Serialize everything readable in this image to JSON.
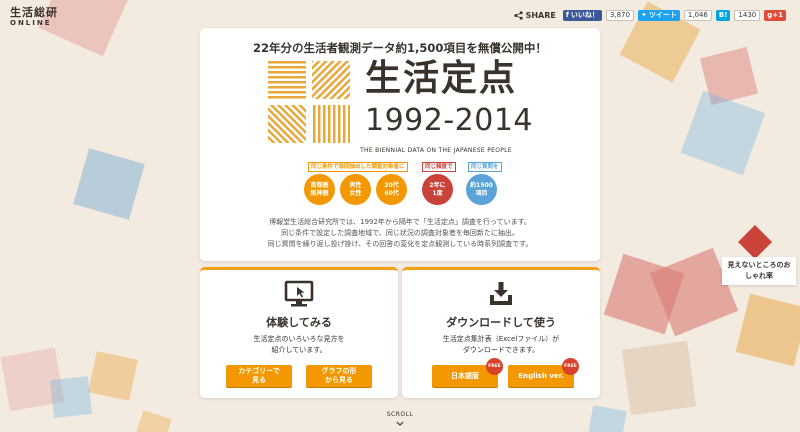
{
  "logo": {
    "top": "生活総研",
    "bottom": "ONLINE"
  },
  "share": {
    "label": "SHARE",
    "facebook": {
      "label": "いいね！",
      "count": "3,870",
      "color": "#3b5998"
    },
    "twitter": {
      "label": "ツイート",
      "count": "1,046",
      "color": "#1da1f2"
    },
    "hatena": {
      "label": "B!",
      "count": "1430",
      "color": "#00a4de"
    },
    "gplus": {
      "label": "g+1",
      "color": "#dd4b39"
    }
  },
  "main": {
    "headline": "22年分の生活者観測データ約1,500項目を無償公開中！",
    "title_ja": "生活定点",
    "title_years": "1992-2014",
    "title_en": "THE BIENNIAL DATA ON THE JAPANESE PEOPLE",
    "captions": [
      {
        "text": "同じ条件で毎回抽出した調査対象者に",
        "color": "#f39800"
      },
      {
        "text": "同じ頻度で",
        "color": "#c9433a"
      },
      {
        "text": "同じ質問を",
        "color": "#5aa3d8"
      }
    ],
    "circles": [
      {
        "text": "首都圏\n阪神圏",
        "color": "#f39800"
      },
      {
        "text": "男性\n女性",
        "color": "#f39800"
      },
      {
        "text": "20代\n60代",
        "color": "#f39800"
      },
      {
        "text": "2年に\n1度",
        "color": "#c9433a"
      },
      {
        "text": "約1500\n項目",
        "color": "#5aa3d8"
      }
    ],
    "description": [
      "博報堂生活総合研究所では、1992年から隔年で「生活定点」調査を行っています。",
      "同じ条件で設定した調査地域で、同じ状況の調査対象者を毎回新たに抽出。",
      "同じ質問を繰り返し投げ掛け、その回答の変化を定点観測している時系列調査です。"
    ]
  },
  "experience": {
    "icon": "monitor-cursor-icon",
    "title": "体験してみる",
    "desc": "生活定点のいろいろな見方を\n紹介しています。",
    "btn_category": "カテゴリーで\n見る",
    "btn_graph": "グラフの形\nから見る"
  },
  "download": {
    "icon": "download-tray-icon",
    "title": "ダウンロードして使う",
    "desc": "生活定点集計表（Excelファイル）が\nダウンロードできます。",
    "btn_japanese": "日本語版",
    "btn_english": "English ver.",
    "free": "FREE"
  },
  "scroll": "SCROLL",
  "promo": {
    "line1": "見えないところのお",
    "line2": "しゃれ率"
  },
  "colors": {
    "accent": "#f39800",
    "red": "#c9433a",
    "blue": "#5aa3d8"
  }
}
